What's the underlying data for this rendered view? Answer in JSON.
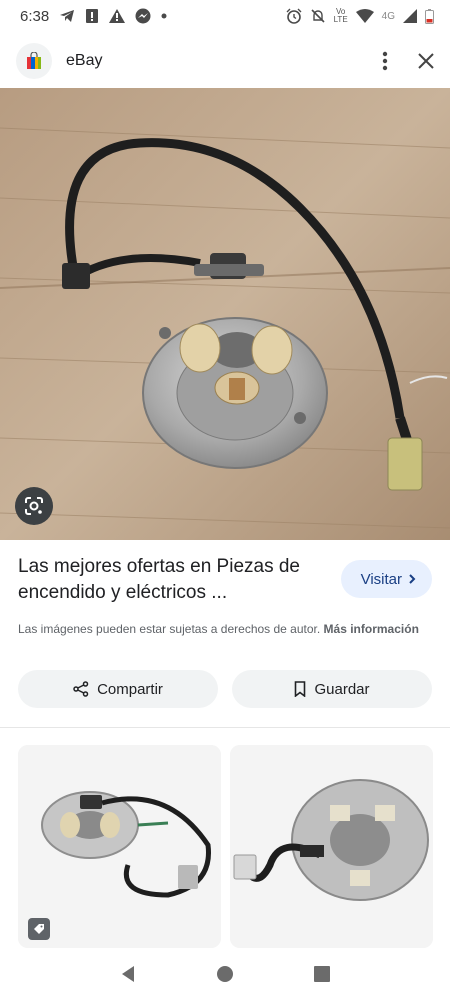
{
  "status": {
    "time": "6:38",
    "lte_top": "Vo",
    "lte_bottom": "LTE",
    "network": "4G"
  },
  "app_bar": {
    "title": "eBay"
  },
  "result": {
    "title": "Las mejores ofertas en Piezas de encendido y eléctricos ...",
    "visit_label": "Visitar",
    "copyright_text": "Las imágenes pueden estar sujetas a derechos de autor.",
    "more_info_label": "Más información"
  },
  "actions": {
    "share_label": "Compartir",
    "save_label": "Guardar"
  },
  "icons": {
    "back": "back-icon",
    "home": "home-icon",
    "recents": "recents-icon"
  },
  "colors": {
    "visit_bg": "#e8f0fe",
    "visit_text": "#1a3f84",
    "pill_bg": "#f1f3f4"
  }
}
